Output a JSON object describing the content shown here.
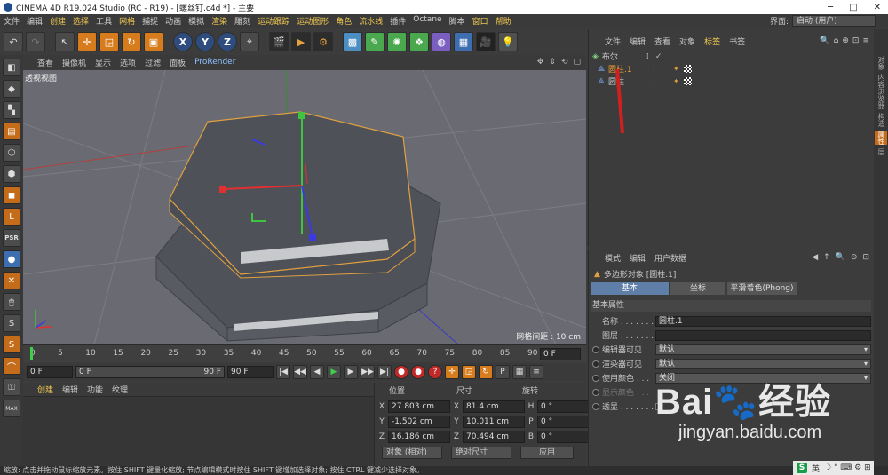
{
  "window": {
    "title": "CINEMA 4D R19.024 Studio (RC - R19) - [螺丝钉.c4d *] - 主要",
    "controls": [
      "─",
      "□",
      "✕"
    ]
  },
  "menubar": {
    "items": [
      {
        "label": "文件",
        "hl": false
      },
      {
        "label": "编辑",
        "hl": false
      },
      {
        "label": "创建",
        "hl": true
      },
      {
        "label": "选择",
        "hl": true
      },
      {
        "label": "工具",
        "hl": false
      },
      {
        "label": "网格",
        "hl": true
      },
      {
        "label": "捕捉",
        "hl": false
      },
      {
        "label": "动画",
        "hl": false
      },
      {
        "label": "模拟",
        "hl": false
      },
      {
        "label": "渲染",
        "hl": true
      },
      {
        "label": "雕刻",
        "hl": false
      },
      {
        "label": "运动跟踪",
        "hl": true
      },
      {
        "label": "运动图形",
        "hl": true
      },
      {
        "label": "角色",
        "hl": true
      },
      {
        "label": "流水线",
        "hl": true
      },
      {
        "label": "插件",
        "hl": false
      },
      {
        "label": "Octane",
        "hl": false
      },
      {
        "label": "脚本",
        "hl": false
      },
      {
        "label": "窗口",
        "hl": true
      },
      {
        "label": "帮助",
        "hl": true
      }
    ],
    "interface_label": "界面:",
    "interface_value": "启动 (用户)"
  },
  "viewport": {
    "menu": [
      "查看",
      "摄像机",
      "显示",
      "选项",
      "过滤",
      "面板"
    ],
    "prorender": "ProRender",
    "label": "透视视图",
    "grid_spacing": "网格间距 : 10 cm",
    "colors": {
      "bg": "#6a6b72",
      "selection": "#e0a040"
    }
  },
  "timeline": {
    "ticks": [
      "0",
      "5",
      "10",
      "15",
      "20",
      "25",
      "30",
      "35",
      "40",
      "45",
      "50",
      "55",
      "60",
      "65",
      "70",
      "75",
      "80",
      "85",
      "90"
    ],
    "current_frame": "0 F"
  },
  "transport": {
    "start": "0 F",
    "range_start": "0 F",
    "range_end": "90 F",
    "end": "90 F"
  },
  "material": {
    "menu": [
      "创建",
      "编辑",
      "功能",
      "纹理"
    ]
  },
  "coords": {
    "headers": {
      "pos": "位置",
      "size": "尺寸",
      "rot": "旋转"
    },
    "rows": [
      {
        "axis": "X",
        "pos": "27.803 cm",
        "saxis": "X",
        "size": "81.4 cm",
        "raxis": "H",
        "rot": "0 °"
      },
      {
        "axis": "Y",
        "pos": "-1.502 cm",
        "saxis": "Y",
        "size": "10.011 cm",
        "raxis": "P",
        "rot": "0 °"
      },
      {
        "axis": "Z",
        "pos": "16.186 cm",
        "saxis": "Z",
        "size": "70.494 cm",
        "raxis": "B",
        "rot": "0 °"
      }
    ],
    "mode": "对象 (相对)",
    "size_mode": "绝对尺寸",
    "apply": "应用"
  },
  "objects": {
    "menu": [
      {
        "label": "文件",
        "act": false
      },
      {
        "label": "编辑",
        "act": false
      },
      {
        "label": "查看",
        "act": false
      },
      {
        "label": "对象",
        "act": false
      },
      {
        "label": "标签",
        "act": true
      },
      {
        "label": "书签",
        "act": false
      }
    ],
    "rows": [
      {
        "name": "布尔",
        "selected": false,
        "check": "✓",
        "tags": false
      },
      {
        "name": "圆柱.1",
        "selected": true,
        "check": "",
        "tags": true
      },
      {
        "name": "圆柱",
        "selected": false,
        "check": "",
        "tags": true
      }
    ]
  },
  "rightrail": {
    "tabs": [
      {
        "label": "对象",
        "act": false
      },
      {
        "label": "内容浏览器",
        "act": false
      },
      {
        "label": "构造",
        "act": false
      },
      {
        "label": "属性",
        "act": true
      },
      {
        "label": "层",
        "act": false
      }
    ]
  },
  "attributes": {
    "menu": [
      "模式",
      "编辑",
      "用户数据"
    ],
    "title": "多边形对象 [圆柱.1]",
    "tabs": [
      {
        "label": "基本",
        "on": true,
        "w": 88
      },
      {
        "label": "坐标",
        "on": false,
        "w": 62
      },
      {
        "label": "平滑着色(Phong)",
        "on": false,
        "w": 78
      }
    ],
    "section": "基本属性",
    "rows": [
      {
        "label": "名称 . . . . . . .",
        "value": "圆柱.1",
        "type": "text",
        "radio": false,
        "dim": false
      },
      {
        "label": "图层 . . . . . . .",
        "value": "",
        "type": "text",
        "radio": false,
        "dim": false
      },
      {
        "label": "编辑器可见",
        "value": "默认",
        "type": "dd",
        "radio": true,
        "dim": false
      },
      {
        "label": "渲染器可见",
        "value": "默认",
        "type": "dd",
        "radio": true,
        "dim": false
      },
      {
        "label": "使用颜色 . . .",
        "value": "关闭",
        "type": "dd",
        "radio": true,
        "dim": false
      },
      {
        "label": "显示颜色 . . .",
        "value": "",
        "type": "none",
        "radio": true,
        "dim": true
      },
      {
        "label": "透显 . . . . . . .",
        "value": "",
        "type": "check",
        "radio": true,
        "dim": false
      }
    ]
  },
  "watermark": {
    "brand": "Bai",
    "paw": "🐾",
    "suffix": "经验",
    "url": "jingyan.baidu.com"
  },
  "tray": {
    "ime": "S",
    "lang": "英",
    "icons": "☽ ° ⌨ ⚙ ⊞"
  },
  "status": "缩放: 点击并拖动鼠标缩放元素。按住 SHIFT 键量化缩放; 节点编辑模式时按住 SHIFT 键增加选择对象; 按住 CTRL 键减少选择对象。"
}
